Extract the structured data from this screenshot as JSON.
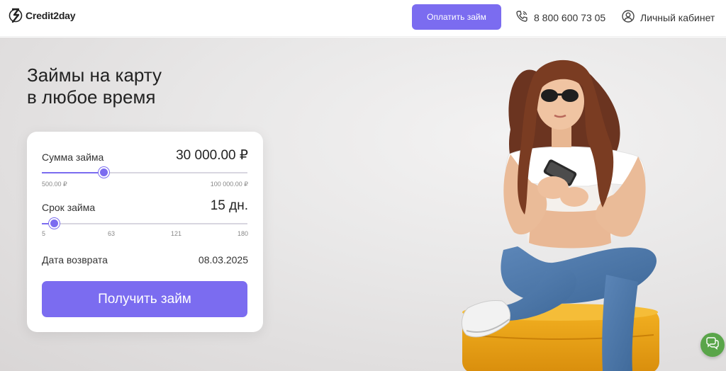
{
  "header": {
    "logo_text": "Credit2day",
    "pay_button": "Оплатить займ",
    "phone": "8 800 600 73 05",
    "cabinet": "Личный кабинет"
  },
  "hero": {
    "title_line1": "Займы на карту",
    "title_line2": "в любое время"
  },
  "calculator": {
    "amount_label": "Сумма займа",
    "amount_value": "30 000.00 ₽",
    "amount_min": "500.00 ₽",
    "amount_max": "100 000.00 ₽",
    "amount_slider_fraction": 0.3,
    "term_label": "Срок займа",
    "term_value": "15 дн.",
    "term_ticks": [
      "5",
      "63",
      "121",
      "180"
    ],
    "term_slider_fraction": 0.06,
    "return_label": "Дата возврата",
    "return_date": "08.03.2025",
    "submit_button": "Получить займ"
  },
  "colors": {
    "accent": "#7b6cf0",
    "chat": "#5aa54a"
  },
  "icons": {
    "logo": "logo-icon",
    "phone": "phone-icon",
    "user": "user-icon",
    "chat": "chat-icon"
  }
}
